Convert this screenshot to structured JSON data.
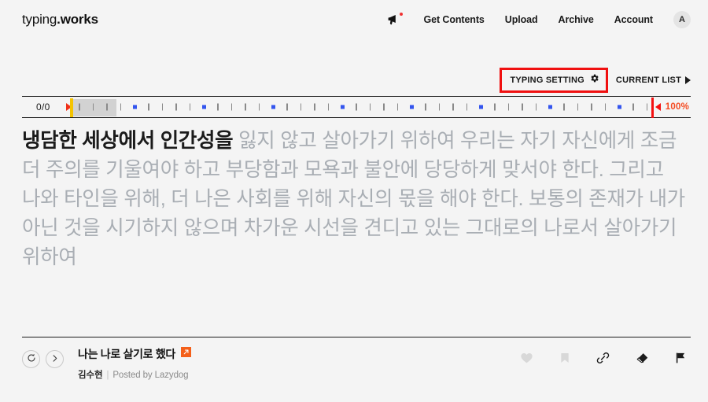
{
  "header": {
    "brand_light": "typing",
    "brand_bold": ".works",
    "announce_icon": "megaphone-icon",
    "nav": [
      {
        "label": "Get Contents"
      },
      {
        "label": "Upload"
      },
      {
        "label": "Archive"
      },
      {
        "label": "Account"
      }
    ],
    "avatar_initial": "A"
  },
  "subbar": {
    "typing_setting_label": "TYPING SETTING",
    "typing_setting_icon": "gear-icon",
    "typing_setting_highlight_color": "#f01010",
    "current_list_label": "CURRENT LIST",
    "current_list_icon": "triangle-right-icon"
  },
  "progress": {
    "count_label": "0/0",
    "percent_label": "100%",
    "cursor_color": "#f5c400",
    "start_marker_color": "#f03018",
    "end_marker_color": "#f41010",
    "tick_color": "#8a8a8a",
    "marker_color": "#3355ee",
    "selection_color": "#d2d2d2",
    "percent_color": "#f44a20"
  },
  "typing": {
    "typed_text": "냉담한 세상에서 인간성을 ",
    "remaining_text": "잃지 않고 살아가기 위하여 우리는 자기 자신에게 조금 더 주의를 기울여야 하고 부당함과 모욕과 불안에 당당하게 맞서야 한다. 그리고 나와 타인을 위해, 더 나은 사회를 위해 자신의 몫을 해야 한다. 보통의 존재가 내가 아닌 것을 시기하지 않으며 차가운 시선을 견디고 있는 그대로의 나로서 살아가기 위하여",
    "typed_color": "#1b1b1b",
    "remaining_color": "#a9aeb4"
  },
  "footer": {
    "restart_icon": "restart-icon",
    "next_icon": "chevron-right-icon",
    "doc_title": "나는 나로 살기로 했다",
    "external_link_icon": "external-link-icon",
    "external_link_color": "#f4601a",
    "author": "김수현",
    "separator": "|",
    "posted_by": "Posted by Lazydog",
    "actions": [
      {
        "name": "like-icon",
        "active": false
      },
      {
        "name": "bookmark-icon",
        "active": false
      },
      {
        "name": "link-icon",
        "active": true
      },
      {
        "name": "eraser-icon",
        "active": true
      },
      {
        "name": "flag-icon",
        "active": true
      }
    ]
  }
}
